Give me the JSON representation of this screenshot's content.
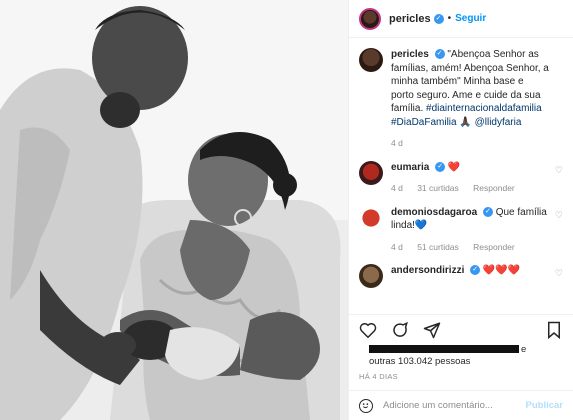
{
  "header": {
    "username": "pericles",
    "separator": "•",
    "follow_label": "Seguir",
    "verified_glyph": "✓"
  },
  "caption": {
    "username": "pericles",
    "text": "\"Abençoa Senhor as famílias, amém! Abençoa Senhor, a minha também\" Minha base e porto seguro. Ame e cuide da sua família.",
    "hashtag1": "#diainternacionaldafamilia",
    "hashtag2": "#DiaDaFamilia",
    "emoji": "🙏🏿",
    "mention": "@llidyfaria",
    "time": "4 d"
  },
  "comments": [
    {
      "username": "eumaria",
      "text": "❤️",
      "time": "4 d",
      "likes": "31 curtidas",
      "reply": "Responder"
    },
    {
      "username": "demoniosdagaroa",
      "text": "Que família linda!💙",
      "time": "4 d",
      "likes": "51 curtidas",
      "reply": "Responder"
    },
    {
      "username": "andersondirizzi",
      "text": "❤️❤️❤️"
    }
  ],
  "likes": {
    "suffix": "e",
    "others": "outras 103.042 pessoas"
  },
  "timestamp": "HÁ 4 DIAS",
  "add_comment": {
    "placeholder": "Adicione um comentário...",
    "post_label": "Publicar"
  },
  "icons": [
    "heart-icon",
    "comment-icon",
    "share-icon",
    "bookmark-icon",
    "emoji-icon"
  ]
}
